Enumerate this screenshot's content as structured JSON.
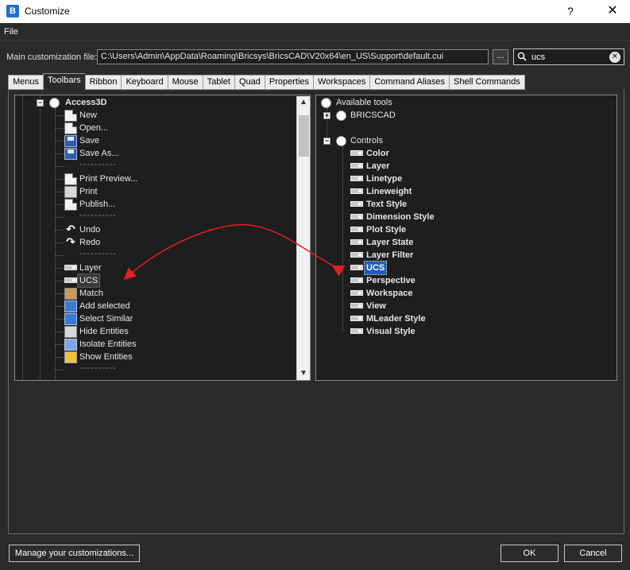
{
  "window": {
    "title": "Customize",
    "help": "?",
    "close": "✕",
    "app_icon": "bricscad-logo-icon"
  },
  "menubar": {
    "file": "File"
  },
  "customization_file": {
    "label": "Main customization file:",
    "value": "C:\\Users\\Admin\\AppData\\Roaming\\Bricsys\\BricsCAD\\V20x64\\en_US\\Support\\default.cui",
    "browse_label": "..."
  },
  "search": {
    "value": "ucs",
    "clear": "✕"
  },
  "tabs": [
    "Menus",
    "Toolbars",
    "Ribbon",
    "Keyboard",
    "Mouse",
    "Tablet",
    "Quad",
    "Properties",
    "Workspaces",
    "Command Aliases",
    "Shell Commands"
  ],
  "left_tree": {
    "root": "Access3D",
    "items": [
      {
        "label": "New",
        "icon": "new-file-icon"
      },
      {
        "label": "Open...",
        "icon": "open-file-icon"
      },
      {
        "label": "Save",
        "icon": "save-icon"
      },
      {
        "label": "Save As...",
        "icon": "save-as-icon"
      },
      {
        "label": "----------",
        "icon": ""
      },
      {
        "label": "Print Preview...",
        "icon": "print-preview-icon"
      },
      {
        "label": "Print",
        "icon": "printer-icon"
      },
      {
        "label": "Publish...",
        "icon": "publish-icon"
      },
      {
        "label": "----------",
        "icon": ""
      },
      {
        "label": "Undo",
        "icon": "undo-icon"
      },
      {
        "label": "Redo",
        "icon": "redo-icon"
      },
      {
        "label": "----------",
        "icon": ""
      },
      {
        "label": "Layer",
        "icon": "toolbar-control-icon"
      },
      {
        "label": "UCS",
        "icon": "toolbar-control-icon"
      },
      {
        "label": "Match",
        "icon": "match-icon"
      },
      {
        "label": "Add selected",
        "icon": "add-selected-icon"
      },
      {
        "label": "Select Similar",
        "icon": "select-similar-icon"
      },
      {
        "label": "Hide Entities",
        "icon": "hide-entities-icon"
      },
      {
        "label": "Isolate Entities",
        "icon": "isolate-entities-icon"
      },
      {
        "label": "Show Entities",
        "icon": "show-entities-icon"
      },
      {
        "label": "----------",
        "icon": ""
      }
    ]
  },
  "right_tree": {
    "root": "Available tools",
    "groups": [
      {
        "label": "BRICSCAD",
        "expanded": false
      },
      {
        "label": "Controls",
        "expanded": true
      }
    ],
    "controls": [
      "Color",
      "Layer",
      "Linetype",
      "Lineweight",
      "Text Style",
      "Dimension Style",
      "Plot Style",
      "Layer State",
      "Layer Filter",
      "UCS",
      "Perspective",
      "Workspace",
      "View",
      "MLeader Style",
      "Visual Style"
    ]
  },
  "buttons": {
    "manage": "Manage your customizations...",
    "ok": "OK",
    "cancel": "Cancel"
  },
  "colors": {
    "accent": "#1c5ec4",
    "annotation": "#e02020",
    "background": "#2b2b2b"
  }
}
